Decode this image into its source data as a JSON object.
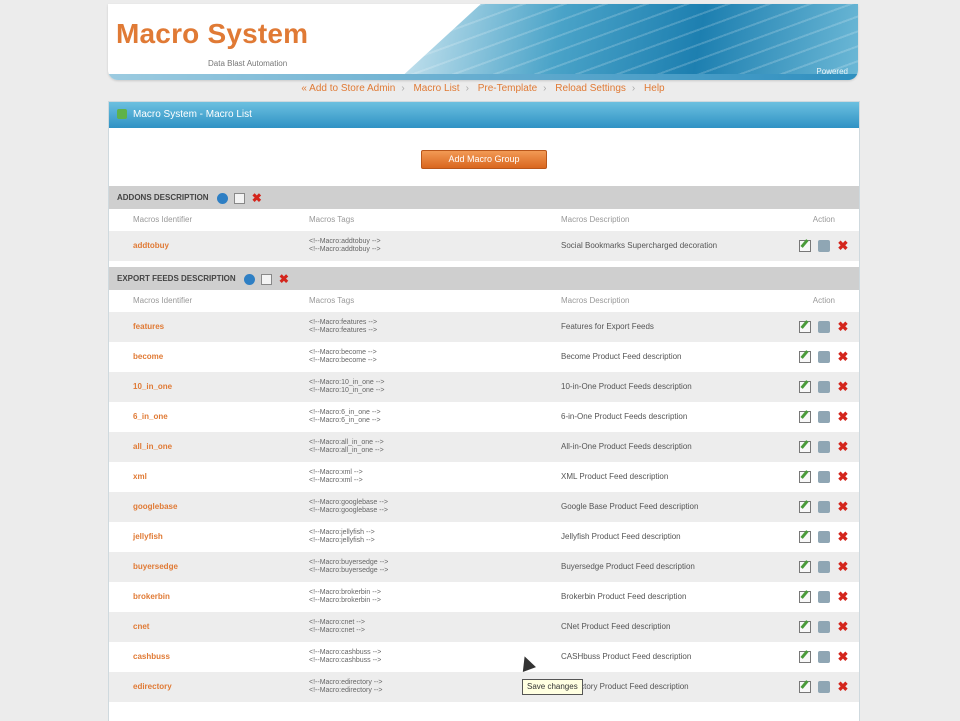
{
  "header": {
    "logo": "Macro System",
    "tagline": "Data Blast Automation",
    "powered": "Powered"
  },
  "nav": {
    "items": [
      "« Add to Store Admin",
      "Macro List",
      "Pre-Template",
      "Reload Settings",
      "Help"
    ]
  },
  "panel": {
    "title": "Macro System - Macro List",
    "add_button": "Add Macro Group"
  },
  "columns": {
    "identifier": "Macros Identifier",
    "tag": "Macros Tags",
    "description": "Macros Description",
    "action": "Action"
  },
  "groups": [
    {
      "title": "ADDONS DESCRIPTION",
      "rows": [
        {
          "id": "addtobuy",
          "tag1": "<!--Macro:addtobuy -->",
          "tag2": "<!--Macro:addtobuy -->",
          "desc": "Social Bookmarks Supercharged decoration"
        }
      ]
    },
    {
      "title": "EXPORT FEEDS DESCRIPTION",
      "rows": [
        {
          "id": "features",
          "tag1": "<!--Macro:features -->",
          "tag2": "<!--Macro:features -->",
          "desc": "Features for Export Feeds"
        },
        {
          "id": "become",
          "tag1": "<!--Macro:become -->",
          "tag2": "<!--Macro:become -->",
          "desc": "Become Product Feed description"
        },
        {
          "id": "10_in_one",
          "tag1": "<!--Macro:10_in_one -->",
          "tag2": "<!--Macro:10_in_one -->",
          "desc": "10-in-One Product Feeds description"
        },
        {
          "id": "6_in_one",
          "tag1": "<!--Macro:6_in_one -->",
          "tag2": "<!--Macro:6_in_one -->",
          "desc": "6-in-One Product Feeds description"
        },
        {
          "id": "all_in_one",
          "tag1": "<!--Macro:all_in_one -->",
          "tag2": "<!--Macro:all_in_one -->",
          "desc": "All-in-One Product Feeds description"
        },
        {
          "id": "xml",
          "tag1": "<!--Macro:xml -->",
          "tag2": "<!--Macro:xml -->",
          "desc": "XML Product Feed description"
        },
        {
          "id": "googlebase",
          "tag1": "<!--Macro:googlebase -->",
          "tag2": "<!--Macro:googlebase -->",
          "desc": "Google Base Product Feed description"
        },
        {
          "id": "jellyfish",
          "tag1": "<!--Macro:jellyfish -->",
          "tag2": "<!--Macro:jellyfish -->",
          "desc": "Jellyfish Product Feed description"
        },
        {
          "id": "buyersedge",
          "tag1": "<!--Macro:buyersedge -->",
          "tag2": "<!--Macro:buyersedge -->",
          "desc": "Buyersedge Product Feed description"
        },
        {
          "id": "brokerbin",
          "tag1": "<!--Macro:brokerbin -->",
          "tag2": "<!--Macro:brokerbin -->",
          "desc": "Brokerbin Product Feed description"
        },
        {
          "id": "cnet",
          "tag1": "<!--Macro:cnet -->",
          "tag2": "<!--Macro:cnet -->",
          "desc": "CNet Product Feed description"
        },
        {
          "id": "cashbuss",
          "tag1": "<!--Macro:cashbuss -->",
          "tag2": "<!--Macro:cashbuss -->",
          "desc": "CASHbuss Product Feed description"
        },
        {
          "id": "edirectory",
          "tag1": "<!--Macro:edirectory -->",
          "tag2": "<!--Macro:edirectory -->",
          "desc": "eDirectory Product Feed description"
        }
      ]
    }
  ],
  "tooltip": "Save changes"
}
